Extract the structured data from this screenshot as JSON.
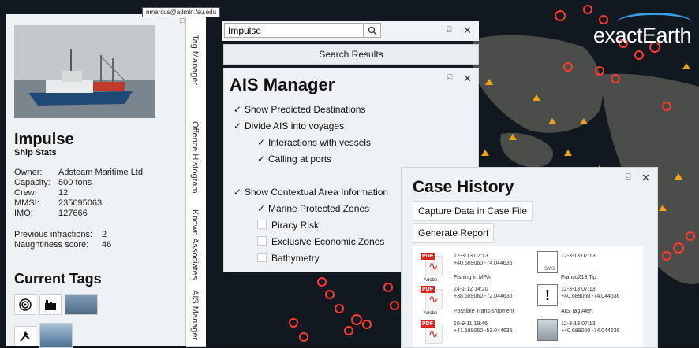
{
  "user": {
    "email": "nmarcus@admin.fsu.edu"
  },
  "logo": {
    "text": "exactEarth"
  },
  "ship": {
    "name": "Impulse",
    "subtitle": "Ship Stats",
    "stats": [
      {
        "label": "Owner:",
        "value": "Adsteam Maritime Ltd"
      },
      {
        "label": "Capacity:",
        "value": "500 tons"
      },
      {
        "label": "Crew:",
        "value": "12"
      },
      {
        "label": "MMSI:",
        "value": "235095063"
      },
      {
        "label": "IMO:",
        "value": "127666"
      }
    ],
    "extra": [
      {
        "label": "Previous infractions:",
        "value": "2"
      },
      {
        "label": "Naughtiness score:",
        "value": "46"
      }
    ]
  },
  "tags": {
    "title": "Current Tags"
  },
  "vtabs": [
    "Tag Manager",
    "Offence Histogram",
    "Known Associates",
    "AIS Manager"
  ],
  "search": {
    "value": "Impulse",
    "results_label": "Search Results"
  },
  "ais": {
    "title": "AIS Manager",
    "options": [
      {
        "label": "Show Predicted Destinations",
        "checked": true,
        "indent": 0
      },
      {
        "label": "Divide AIS into voyages",
        "checked": true,
        "indent": 0
      },
      {
        "label": "Interactions with vessels",
        "checked": true,
        "indent": 1
      },
      {
        "label": "Calling at ports",
        "checked": true,
        "indent": 1
      },
      {
        "label": "Show Contextual Area Information",
        "checked": true,
        "indent": 0
      },
      {
        "label": "Marine Protected Zones",
        "checked": true,
        "indent": 1
      },
      {
        "label": "Piracy Risk",
        "checked": false,
        "indent": 1
      },
      {
        "label": "Exclusive Economic Zones",
        "checked": false,
        "indent": 1
      },
      {
        "label": "Bathymetry",
        "checked": false,
        "indent": 1
      }
    ]
  },
  "case": {
    "title": "Case History",
    "capture_label": "Capture Data in Case File",
    "report_label": "Generate Report",
    "items": [
      {
        "date": "12-3-13 07:13",
        "coords": "+40.689060 -74.044636",
        "title": "Fishing in MPA",
        "type": "pdf"
      },
      {
        "date": "12-3-13 07:13",
        "coords": "",
        "title": "Franco213 Tip",
        "type": "sms"
      },
      {
        "date": "24-1-12 14:20",
        "coords": "+38.689060 -72.044636",
        "title": "Possible Trans-shipment",
        "type": "pdf"
      },
      {
        "date": "12-3-13 07:13",
        "coords": "+40.689060 -74.044636",
        "title": "AIS Tag Alert",
        "type": "alert"
      },
      {
        "date": "10-9-11 19:46",
        "coords": "+41.689060 -53.044636",
        "title": "",
        "type": "pdf"
      },
      {
        "date": "12-3-13 07:13",
        "coords": "+40.689060 -74.044636",
        "title": "",
        "type": "photo"
      }
    ],
    "sms_label": "SMS",
    "pdf_label": "PDF",
    "adobe_label": "Adobe",
    "alert_glyph": "!"
  },
  "glyphs": {
    "pin": "⍇",
    "close": "✕",
    "check": "✓",
    "search": "⚲"
  }
}
